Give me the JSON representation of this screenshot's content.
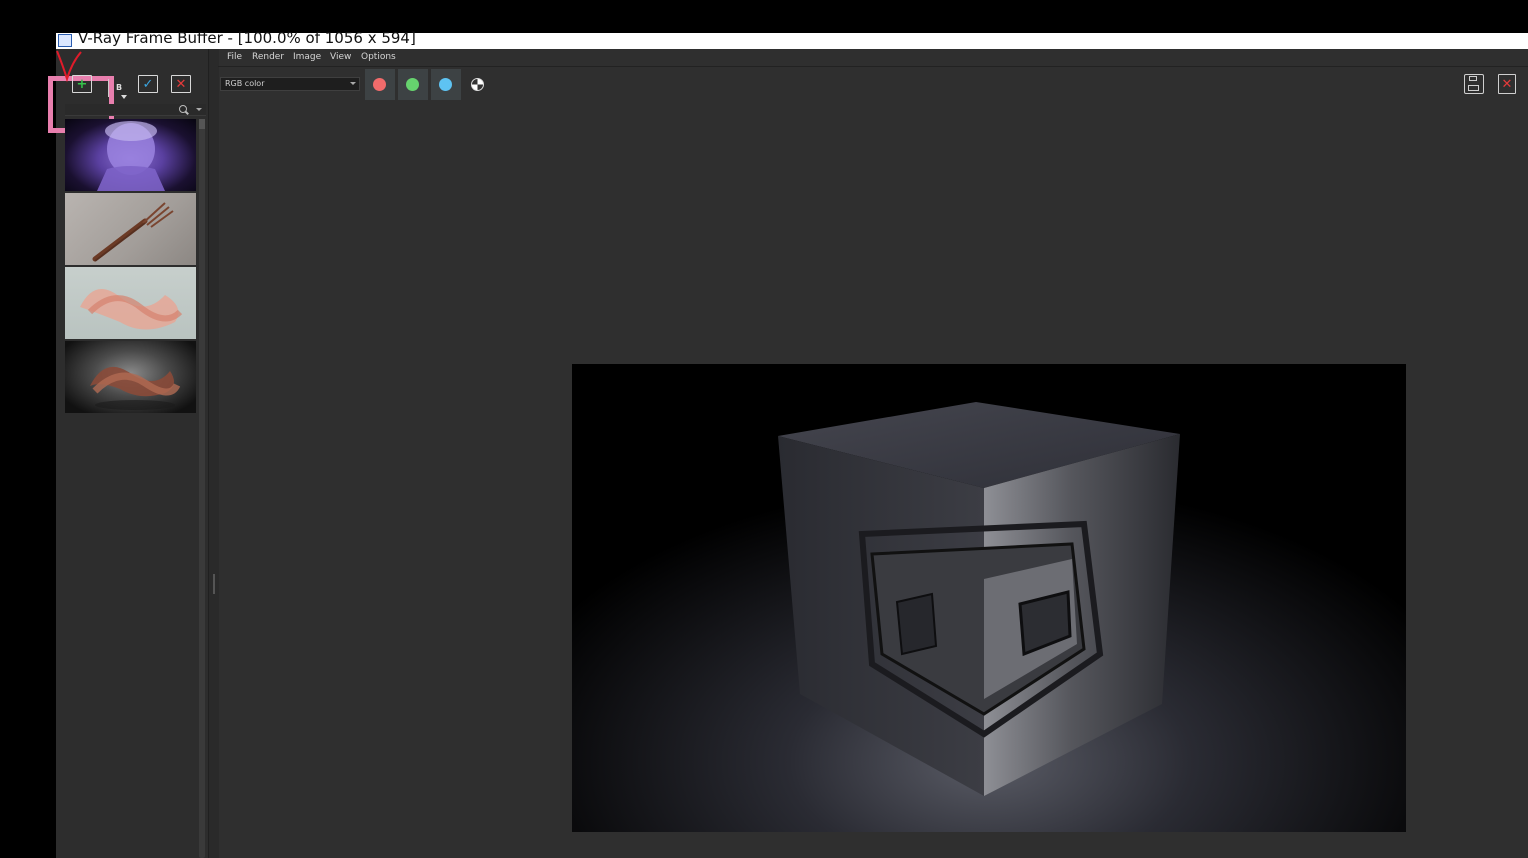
{
  "window": {
    "title": "V-Ray Frame Buffer - [100.0% of 1056 x 594]"
  },
  "menu": {
    "items": [
      "File",
      "Render",
      "Image",
      "View",
      "Options"
    ]
  },
  "history_toolbar": {
    "add_icon": "add-to-history-icon",
    "ab_label": "B",
    "check_icon": "load-image-check-icon",
    "delete_icon": "delete-image-icon"
  },
  "history": {
    "thumbnails": [
      {
        "icon": "statue-bust-render"
      },
      {
        "icon": "fork-render"
      },
      {
        "icon": "glass-ribbon-render"
      },
      {
        "icon": "copper-ribbon-render"
      }
    ]
  },
  "toolbar": {
    "channel_value": "RGB color",
    "channel_buttons": [
      {
        "name": "red",
        "color": "#f16b6b"
      },
      {
        "name": "green",
        "color": "#66d36e"
      },
      {
        "name": "blue",
        "color": "#5ec3f2"
      }
    ],
    "mono_icon": "monochrome-icon",
    "save_icon": "save-icon",
    "clear_icon": "clear-image-icon"
  },
  "colors": {
    "panel_bg": "#2f2f2f",
    "highlight": "#e87fae",
    "add_green": "#35c24a",
    "delete_red": "#e53a3a"
  }
}
